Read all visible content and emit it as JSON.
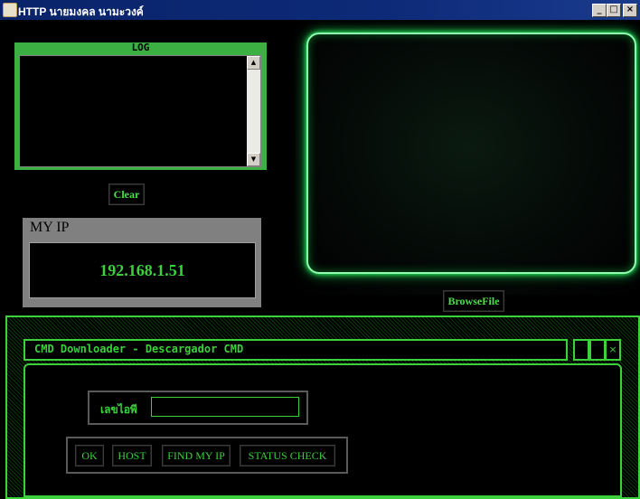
{
  "window": {
    "title": "HTTP นายมงคล นามะวงค์",
    "minimize_glyph": "_",
    "maximize_glyph": "□",
    "close_glyph": "×"
  },
  "log": {
    "title": "LOG",
    "content": "",
    "clear_label": "Clear"
  },
  "my_ip": {
    "label": "MY IP",
    "value": "192.168.1.51"
  },
  "browse": {
    "label": "BrowseFile"
  },
  "cmd": {
    "title": "CMD Downloader - Descargador CMD",
    "close_glyph": "×",
    "field_label": "เลขไอพี",
    "field_value": "",
    "buttons": {
      "ok": "OK",
      "host": "HOST",
      "find_my_ip": "FIND MY IP",
      "status_check": "STATUS CHECK"
    }
  },
  "colors": {
    "accent_green": "#3cd03c",
    "title_blue": "#0a246a"
  }
}
